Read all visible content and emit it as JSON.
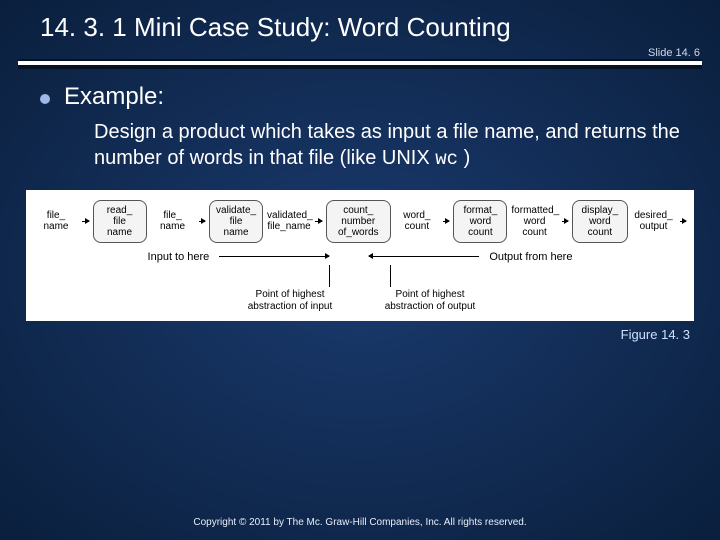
{
  "header": {
    "title": "14. 3. 1  Mini Case Study: Word Counting",
    "slide_num": "Slide 14. 6"
  },
  "bullet": {
    "label": "Example:"
  },
  "body": {
    "text_prefix": "Design a product which takes as input a file name, and returns the number of words in that file (like UNIX ",
    "mono": "wc",
    "text_suffix": " )"
  },
  "diagram": {
    "arrows": {
      "a0": "file_ name",
      "a1": "file_ name",
      "a2": "validated_ file_name",
      "a3": "word_ count",
      "a4": "formatted_ word count",
      "a5": "desired_ output"
    },
    "boxes": {
      "b0": "read_ file name",
      "b1": "validate_ file name",
      "b2": "count_ number of_words",
      "b3": "format_ word count",
      "b4": "display_ word count"
    },
    "io": {
      "input_label": "Input to here",
      "output_label": "Output from here"
    },
    "abstraction": {
      "left": "Point of highest abstraction of input",
      "right": "Point of highest abstraction of output"
    }
  },
  "figure_caption": "Figure 14. 3",
  "copyright": "Copyright © 2011 by The Mc. Graw-Hill Companies, Inc.  All rights reserved."
}
